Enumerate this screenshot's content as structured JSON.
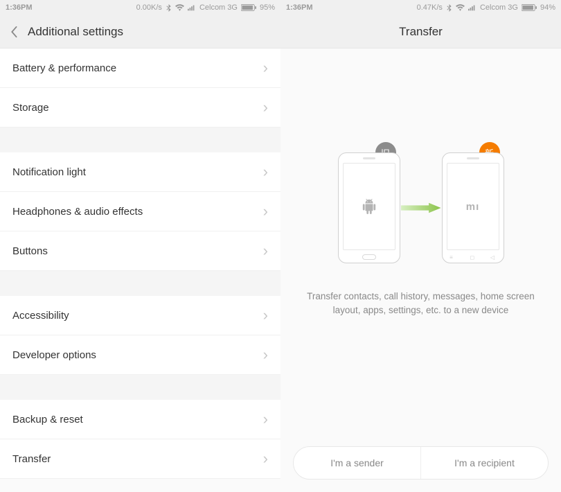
{
  "left": {
    "status": {
      "time": "1:36PM",
      "speed": "0.00K/s",
      "carrier": "Celcom 3G",
      "battery": "95%"
    },
    "titlebar": {
      "title": "Additional settings"
    },
    "groups": [
      {
        "items": [
          {
            "label": "Battery & performance"
          },
          {
            "label": "Storage"
          }
        ]
      },
      {
        "items": [
          {
            "label": "Notification light"
          },
          {
            "label": "Headphones & audio effects"
          },
          {
            "label": "Buttons"
          }
        ]
      },
      {
        "items": [
          {
            "label": "Accessibility"
          },
          {
            "label": "Developer options"
          }
        ]
      },
      {
        "items": [
          {
            "label": "Backup & reset"
          },
          {
            "label": "Transfer"
          }
        ]
      }
    ]
  },
  "right": {
    "status": {
      "time": "1:36PM",
      "speed": "0.47K/s",
      "carrier": "Celcom 3G",
      "battery": "94%"
    },
    "titlebar": {
      "title": "Transfer"
    },
    "illus": {
      "old_badge": "旧",
      "new_badge": "新",
      "mi_label": "mı"
    },
    "description": "Transfer contacts, call history, messages, home screen layout, apps, settings, etc. to a new device",
    "buttons": {
      "sender": "I'm a sender",
      "recipient": "I'm a recipient"
    }
  }
}
